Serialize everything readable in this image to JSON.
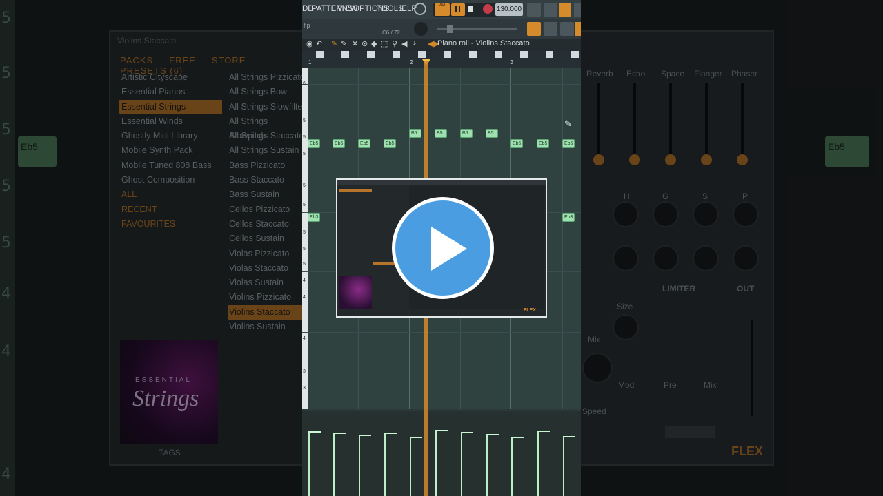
{
  "menu": [
    "DD",
    "PATTERNS",
    "VIEW",
    "OPTIONS",
    "TOOLS",
    "HELP"
  ],
  "transport": {
    "pat_label": "PAT",
    "tempo": "130.000",
    "pattern_info": "C6 / 72",
    "prefix": "flp"
  },
  "piano_roll": {
    "title": "Piano roll - Violins Staccato",
    "bars": [
      "1",
      "2",
      "3"
    ]
  },
  "notes": [
    "Eb5",
    "Eb5",
    "Eb5",
    "Eb5",
    "B5",
    "B5",
    "B5",
    "B5",
    "Eb5",
    "Eb5",
    "Eb5",
    "Eb3",
    "Eb3"
  ],
  "key_labels": [
    "6",
    "5",
    "5",
    "5",
    "5",
    "5",
    "5",
    "5",
    "5",
    "4",
    "4",
    "4",
    "3",
    "3"
  ],
  "bg_key_labels": [
    "5",
    "5",
    "5",
    "5",
    "4",
    "4",
    "4"
  ],
  "bg_notes": [
    "Eb5",
    "Eb5"
  ],
  "browser": {
    "title": "Violins Staccato",
    "tabs": [
      "PACKS",
      "FREE",
      "STORE",
      "PRESETS (6)"
    ],
    "packs": [
      "Artistic Cityscape",
      "Essential Pianos",
      "Essential Strings",
      "Essential Winds",
      "Ghostly Midi Library",
      "Mobile Synth Pack",
      "Mobile Tuned 808 Bass",
      "Ghost Composition",
      "ALL",
      "RECENT",
      "FAVOURITES"
    ],
    "presets": [
      "All Strings Pizzicato",
      "All Strings Bow",
      "All Strings Slowfilter",
      "All Strings Slowpitch",
      "All Strings Staccato",
      "All Strings Sustain",
      "Bass Pizzicato",
      "Bass Staccato",
      "Bass Sustain",
      "Cellos Pizzicato",
      "Cellos Staccato",
      "Cellos Sustain",
      "Violas Pizzicato",
      "Violas Staccato",
      "Violas Sustain",
      "Violins Pizzicato",
      "Violins Staccato",
      "Violins Sustain"
    ],
    "cover_top": "ESSENTIAL",
    "cover_script": "Strings",
    "footer": "TAGS"
  },
  "synth": {
    "fx_labels": [
      "Reverb",
      "Echo",
      "Space",
      "Flanger",
      "Phaser"
    ],
    "row_labels": [
      "H",
      "G",
      "S",
      "P"
    ],
    "limiter": "LIMITER",
    "out": "OUT",
    "knob_labels": [
      "Size",
      "Mix",
      "Mod",
      "Speed",
      "Pre",
      "Mix"
    ],
    "brand": "FLEX"
  },
  "colors": {
    "accent": "#d58a2b",
    "note": "#9fe0b0",
    "play_button": "#4a9de0"
  }
}
